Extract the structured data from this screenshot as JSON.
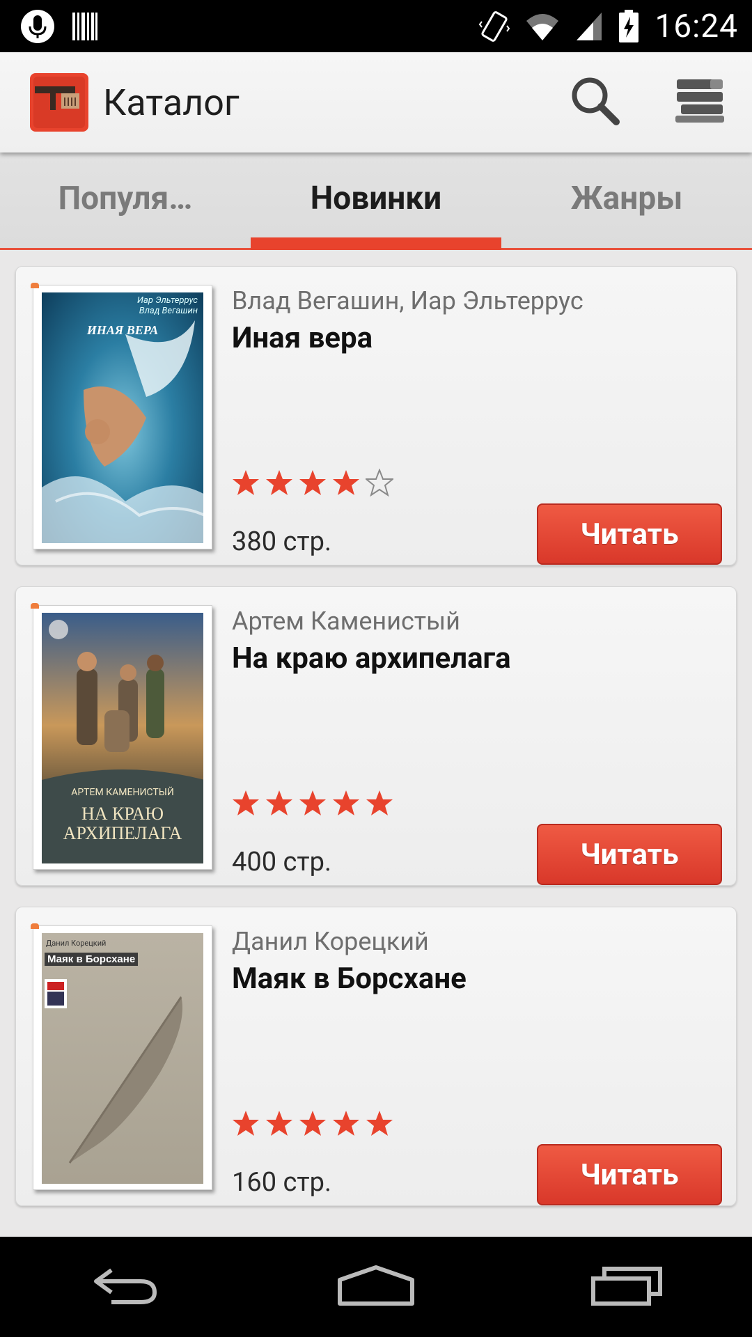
{
  "status_bar": {
    "time": "16:24",
    "icons": [
      "microphone-icon",
      "barcode-icon",
      "vibrate-icon",
      "wifi-icon",
      "signal-icon",
      "battery-charging-icon"
    ]
  },
  "app_bar": {
    "title": "Каталог",
    "logo_icon": "library-app-logo",
    "actions": [
      "search-icon",
      "bookshelf-icon"
    ]
  },
  "tabs": [
    {
      "label": "Популя…",
      "active": false
    },
    {
      "label": "Новинки",
      "active": true
    },
    {
      "label": "Жанры",
      "active": false
    }
  ],
  "books": [
    {
      "author": "Влад Вегашин, Иар Эльтеррус",
      "title": "Иная вера",
      "rating": 4,
      "rating_max": 5,
      "pages": "380 стр.",
      "read_label": "Читать",
      "cover": {
        "top_authors": "Иар Эльтеррус\nВлад Вегашин",
        "cover_title": "ИНАЯ ВЕРА"
      }
    },
    {
      "author": "Артем Каменистый",
      "title": "На краю архипелага",
      "rating": 5,
      "rating_max": 5,
      "pages": "400 стр.",
      "read_label": "Читать",
      "cover": {
        "top_authors": "АРТЕМ КАМЕНИСТЫЙ",
        "cover_title": "НА КРАЮ\nАРХИПЕЛАГА"
      }
    },
    {
      "author": "Данил Корецкий",
      "title": "Маяк в Борсхане",
      "rating": 5,
      "rating_max": 5,
      "pages": "160 стр.",
      "read_label": "Читать",
      "cover": {
        "top_authors": "Данил Корецкий",
        "cover_title": "Маяк в Борсхане"
      }
    }
  ],
  "colors": {
    "accent": "#e8432d",
    "star": "#e8432d",
    "button": "#e24a35"
  },
  "nav_bar": [
    "back-icon",
    "home-icon",
    "recent-apps-icon"
  ]
}
